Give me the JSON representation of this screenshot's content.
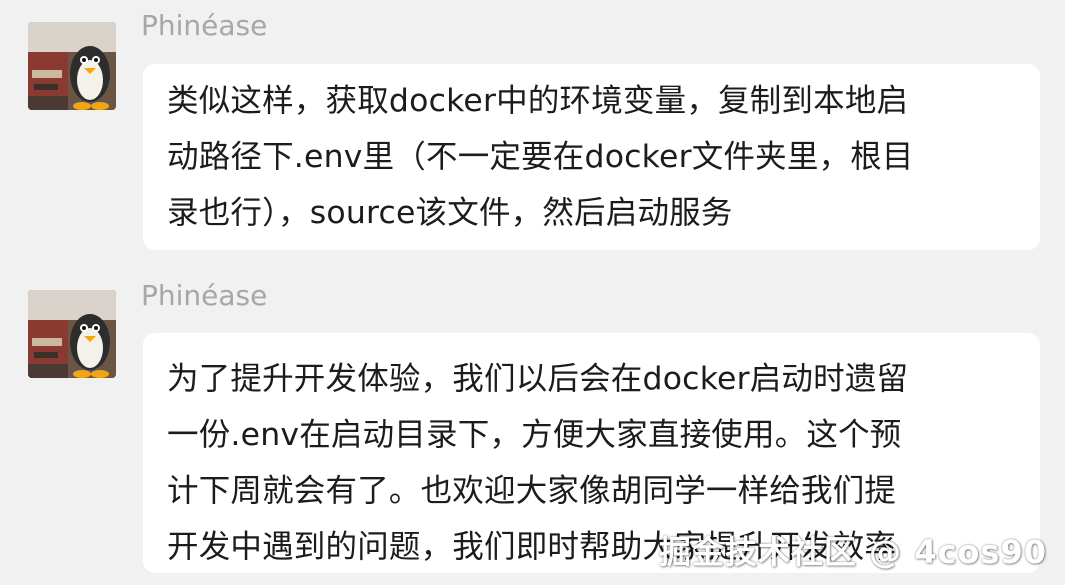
{
  "messages": [
    {
      "sender": "Phinéase",
      "lines": [
        "类似这样，获取docker中的环境变量，复制到本地启",
        "动路径下.env里（不一定要在docker文件夹里，根目",
        "录也行），source该文件，然后启动服务"
      ]
    },
    {
      "sender": "Phinéase",
      "lines": [
        "为了提升开发体验，我们以后会在docker启动时遗留",
        "一份.env在启动目录下，方便大家直接使用。这个预",
        "计下周就会有了。也欢迎大家像胡同学一样给我们提",
        "开发中遇到的问题，我们即时帮助大家提升开发效率"
      ]
    }
  ],
  "watermark": "掘金技术社区 @ 4cos90",
  "colors": {
    "background": "#f1f1f1",
    "bubble": "#ffffff",
    "sender": "#a7a7a7",
    "text": "#1c1c1c"
  }
}
